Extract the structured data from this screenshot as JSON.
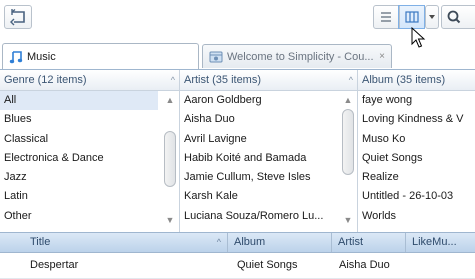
{
  "toolbar": {
    "back_icon": "return-arrow-icon",
    "view_list_icon": "list-view-icon",
    "view_columns_icon": "column-view-icon",
    "dropdown_icon": "chevron-down-icon",
    "search_icon": "search-icon",
    "search_partial": ""
  },
  "tabs": [
    {
      "label": "Music",
      "icon": "music-note-icon"
    },
    {
      "label": "Welcome to Simplicity - Cou...",
      "icon": "browser-page-icon",
      "close": "×"
    }
  ],
  "genre_pane": {
    "header": "Genre (12 items)",
    "sort_indicator": "^",
    "items": [
      "All",
      "Blues",
      "Classical",
      "Electronica & Dance",
      "Jazz",
      "Latin",
      "Other"
    ],
    "selected": "All"
  },
  "artist_pane": {
    "header": "Artist (35 items)",
    "sort_indicator": "^",
    "items": [
      "Aaron Goldberg",
      "Aisha Duo",
      "Avril Lavigne",
      "Habib Koité and Bamada",
      "Jamie Cullum, Steve Isles",
      "Karsh Kale",
      "Luciana Souza/Romero Lu..."
    ]
  },
  "album_pane": {
    "header": "Album (35 items)",
    "items": [
      "faye wong",
      "Loving Kindness & V",
      "Muso Ko",
      "Quiet Songs",
      "Realize",
      "Untitled - 26-10-03",
      "Worlds"
    ]
  },
  "tracks": {
    "columns": {
      "title": "Title",
      "sort_indicator": "^",
      "album": "Album",
      "artist": "Artist",
      "likemu": "LikeMu..."
    },
    "rows": [
      {
        "title": "Despertar",
        "album": "Quiet Songs",
        "artist": "Aisha Duo"
      }
    ]
  },
  "colors": {
    "accent": "#7fb0e6",
    "header_bg": "#bcd2ea",
    "selection": "#dfe9f6"
  }
}
